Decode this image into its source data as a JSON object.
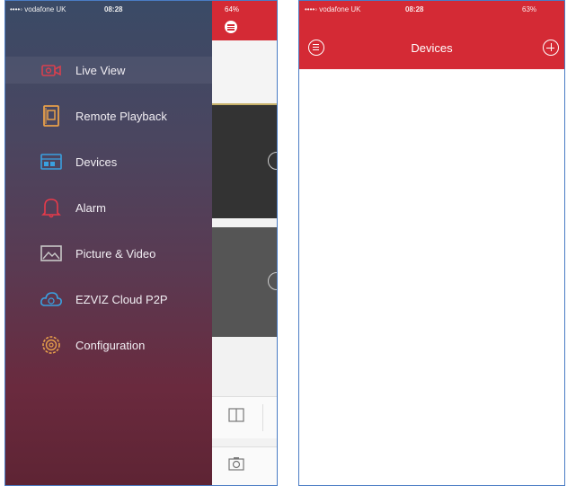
{
  "left_phone": {
    "status": {
      "carrier": "••••◦ vodafone UK",
      "time": "08:28",
      "battery": "64%"
    },
    "menu": [
      {
        "label": "Live View",
        "icon": "camera-icon",
        "color": "#e83a4a"
      },
      {
        "label": "Remote Playback",
        "icon": "playback-icon",
        "color": "#e8a04a"
      },
      {
        "label": "Devices",
        "icon": "devices-icon",
        "color": "#3aa0e0"
      },
      {
        "label": "Alarm",
        "icon": "bell-icon",
        "color": "#e83a4a"
      },
      {
        "label": "Picture & Video",
        "icon": "picture-icon",
        "color": "#bbbbbb"
      },
      {
        "label": "EZVIZ Cloud P2P",
        "icon": "cloud-icon",
        "color": "#3aa0e0"
      },
      {
        "label": "Configuration",
        "icon": "gear-icon",
        "color": "#e8a04a"
      }
    ]
  },
  "right_phone": {
    "status": {
      "carrier": "••••◦ vodafone UK",
      "time": "08:28",
      "battery": "63%"
    },
    "title": "Devices"
  },
  "colors": {
    "accent": "#d42a35"
  }
}
